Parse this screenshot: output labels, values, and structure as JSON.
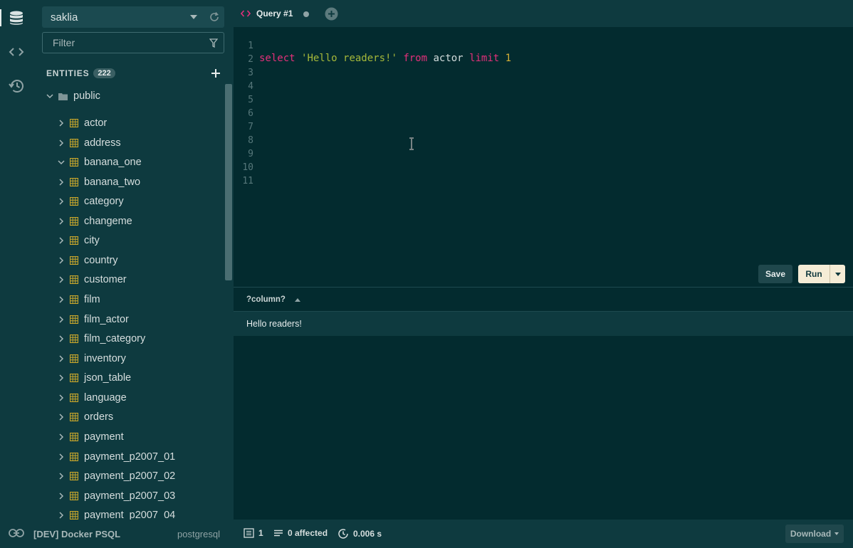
{
  "rail": {
    "items": [
      {
        "icon": "database-icon"
      },
      {
        "icon": "code-icon"
      },
      {
        "icon": "history-icon"
      }
    ]
  },
  "sidebar": {
    "connection": "saklia",
    "filter_placeholder": "Filter",
    "entities_label": "ENTITIES",
    "entities_count": "222",
    "schema": "public",
    "tables": [
      "actor",
      "address",
      "banana_one",
      "banana_two",
      "category",
      "changeme",
      "city",
      "country",
      "customer",
      "film",
      "film_actor",
      "film_category",
      "inventory",
      "json_table",
      "language",
      "orders",
      "payment",
      "payment_p2007_01",
      "payment_p2007_02",
      "payment_p2007_03",
      "payment_p2007_04"
    ]
  },
  "footer_left": {
    "connection_name": "[DEV] Docker PSQL",
    "connection_type": "postgresql"
  },
  "tabs": {
    "active_label": "Query #1"
  },
  "editor": {
    "line_numbers": [
      "1",
      "2",
      "3",
      "4",
      "5",
      "6",
      "7",
      "8",
      "9",
      "10",
      "11"
    ],
    "tokens": {
      "select": "select",
      "string": "'Hello readers!'",
      "from": "from",
      "table": "actor",
      "limit": "limit",
      "number": "1"
    },
    "save_label": "Save",
    "run_label": "Run"
  },
  "results": {
    "column": "?column?",
    "row_value": "Hello readers!"
  },
  "statusbar": {
    "rows": "1",
    "affected": "0 affected",
    "time": "0.006 s",
    "download_label": "Download"
  },
  "colors": {
    "background": "#032b2f",
    "panel": "#0e3a3f",
    "keyword": "#e3307a",
    "string": "#a5b83a",
    "number": "#d6b035",
    "table_icon": "#c9a72c",
    "run_button": "#f5ecd6"
  }
}
